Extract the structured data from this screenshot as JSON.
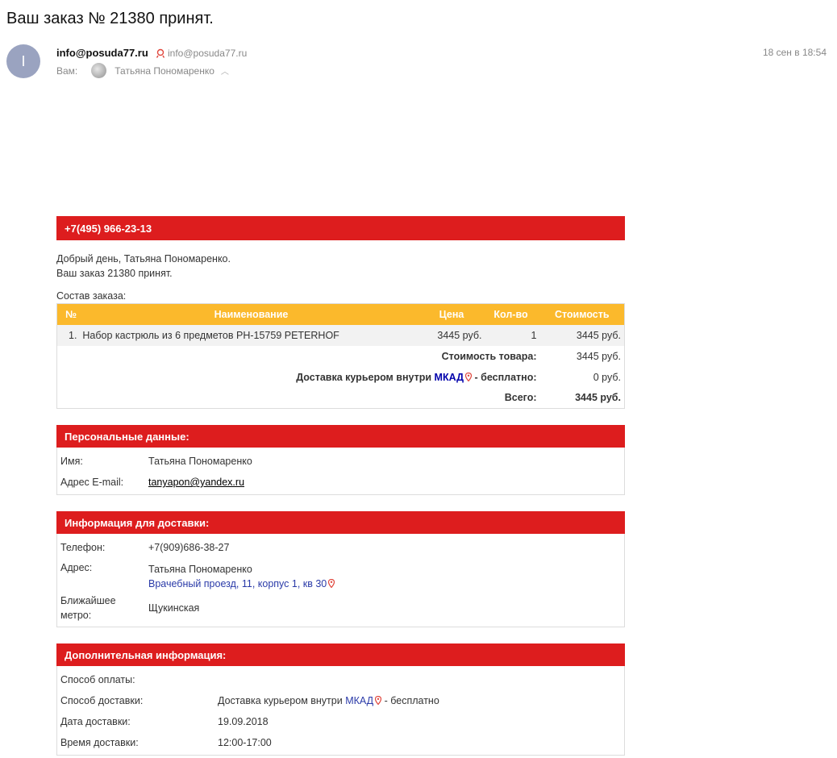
{
  "subject": "Ваш заказ № 21380 принят.",
  "sender": {
    "avatar_letter": "I",
    "name": "info@posuda77.ru",
    "email": "info@posuda77.ru",
    "to_label": "Вам:",
    "to_name": "Татьяна Пономаренко",
    "date": "18 сен в 18:54"
  },
  "letter": {
    "phone": "+7(495) 966-23-13",
    "greeting": "Добрый день, Татьяна Пономаренко.",
    "accepted": "Ваш заказ 21380 принят.",
    "order_label": "Состав заказа:",
    "table": {
      "headers": [
        "№",
        "Наименование",
        "Цена",
        "Кол-во",
        "Стоимость"
      ],
      "items": [
        {
          "num": "1.",
          "name": "Набор кастрюль из 6 предметов РН-15759 PETERHOF",
          "price": "3445 руб.",
          "qty": "1",
          "cost": "3445 руб."
        }
      ],
      "subtotal_label": "Стоимость товара:",
      "subtotal_value": "3445 руб.",
      "delivery_label_start": "Доставка курьером внутри",
      "delivery_link": "МКАД",
      "delivery_label_end": "- бесплатно:",
      "delivery_value": "0 руб.",
      "total_label": "Всего:",
      "total_value": "3445 руб."
    },
    "personal": {
      "title": "Персональные данные:",
      "name_label": "Имя:",
      "name_value": "Татьяна Пономаренко",
      "email_label": "Адрес E-mail:",
      "email_value": "tanyapon@yandex.ru"
    },
    "delivery_info": {
      "title": "Информация для доставки:",
      "phone_label": "Телефон:",
      "phone_value": "+7(909)686-38-27",
      "address_label": "Адрес:",
      "address_name": "Татьяна Пономаренко",
      "address_value": "Врачебный проезд, 11, корпус 1, кв 30",
      "metro_label": "Ближайшее метро:",
      "metro_value": "Щукинская"
    },
    "additional": {
      "title": "Дополнительная информация:",
      "payment_label": "Способ оплаты:",
      "payment_value": "",
      "method_label": "Способ доставки:",
      "method_start": "Доставка курьером внутри",
      "method_link": "МКАД",
      "method_end": "- бесплатно",
      "date_label": "Дата доставки:",
      "date_value": "19.09.2018",
      "time_label": "Время доставки:",
      "time_value": "12:00-17:00"
    }
  },
  "colors": {
    "red": "#dd1d1e",
    "orange": "#fbb92c",
    "link_blue": "#0000ab"
  }
}
